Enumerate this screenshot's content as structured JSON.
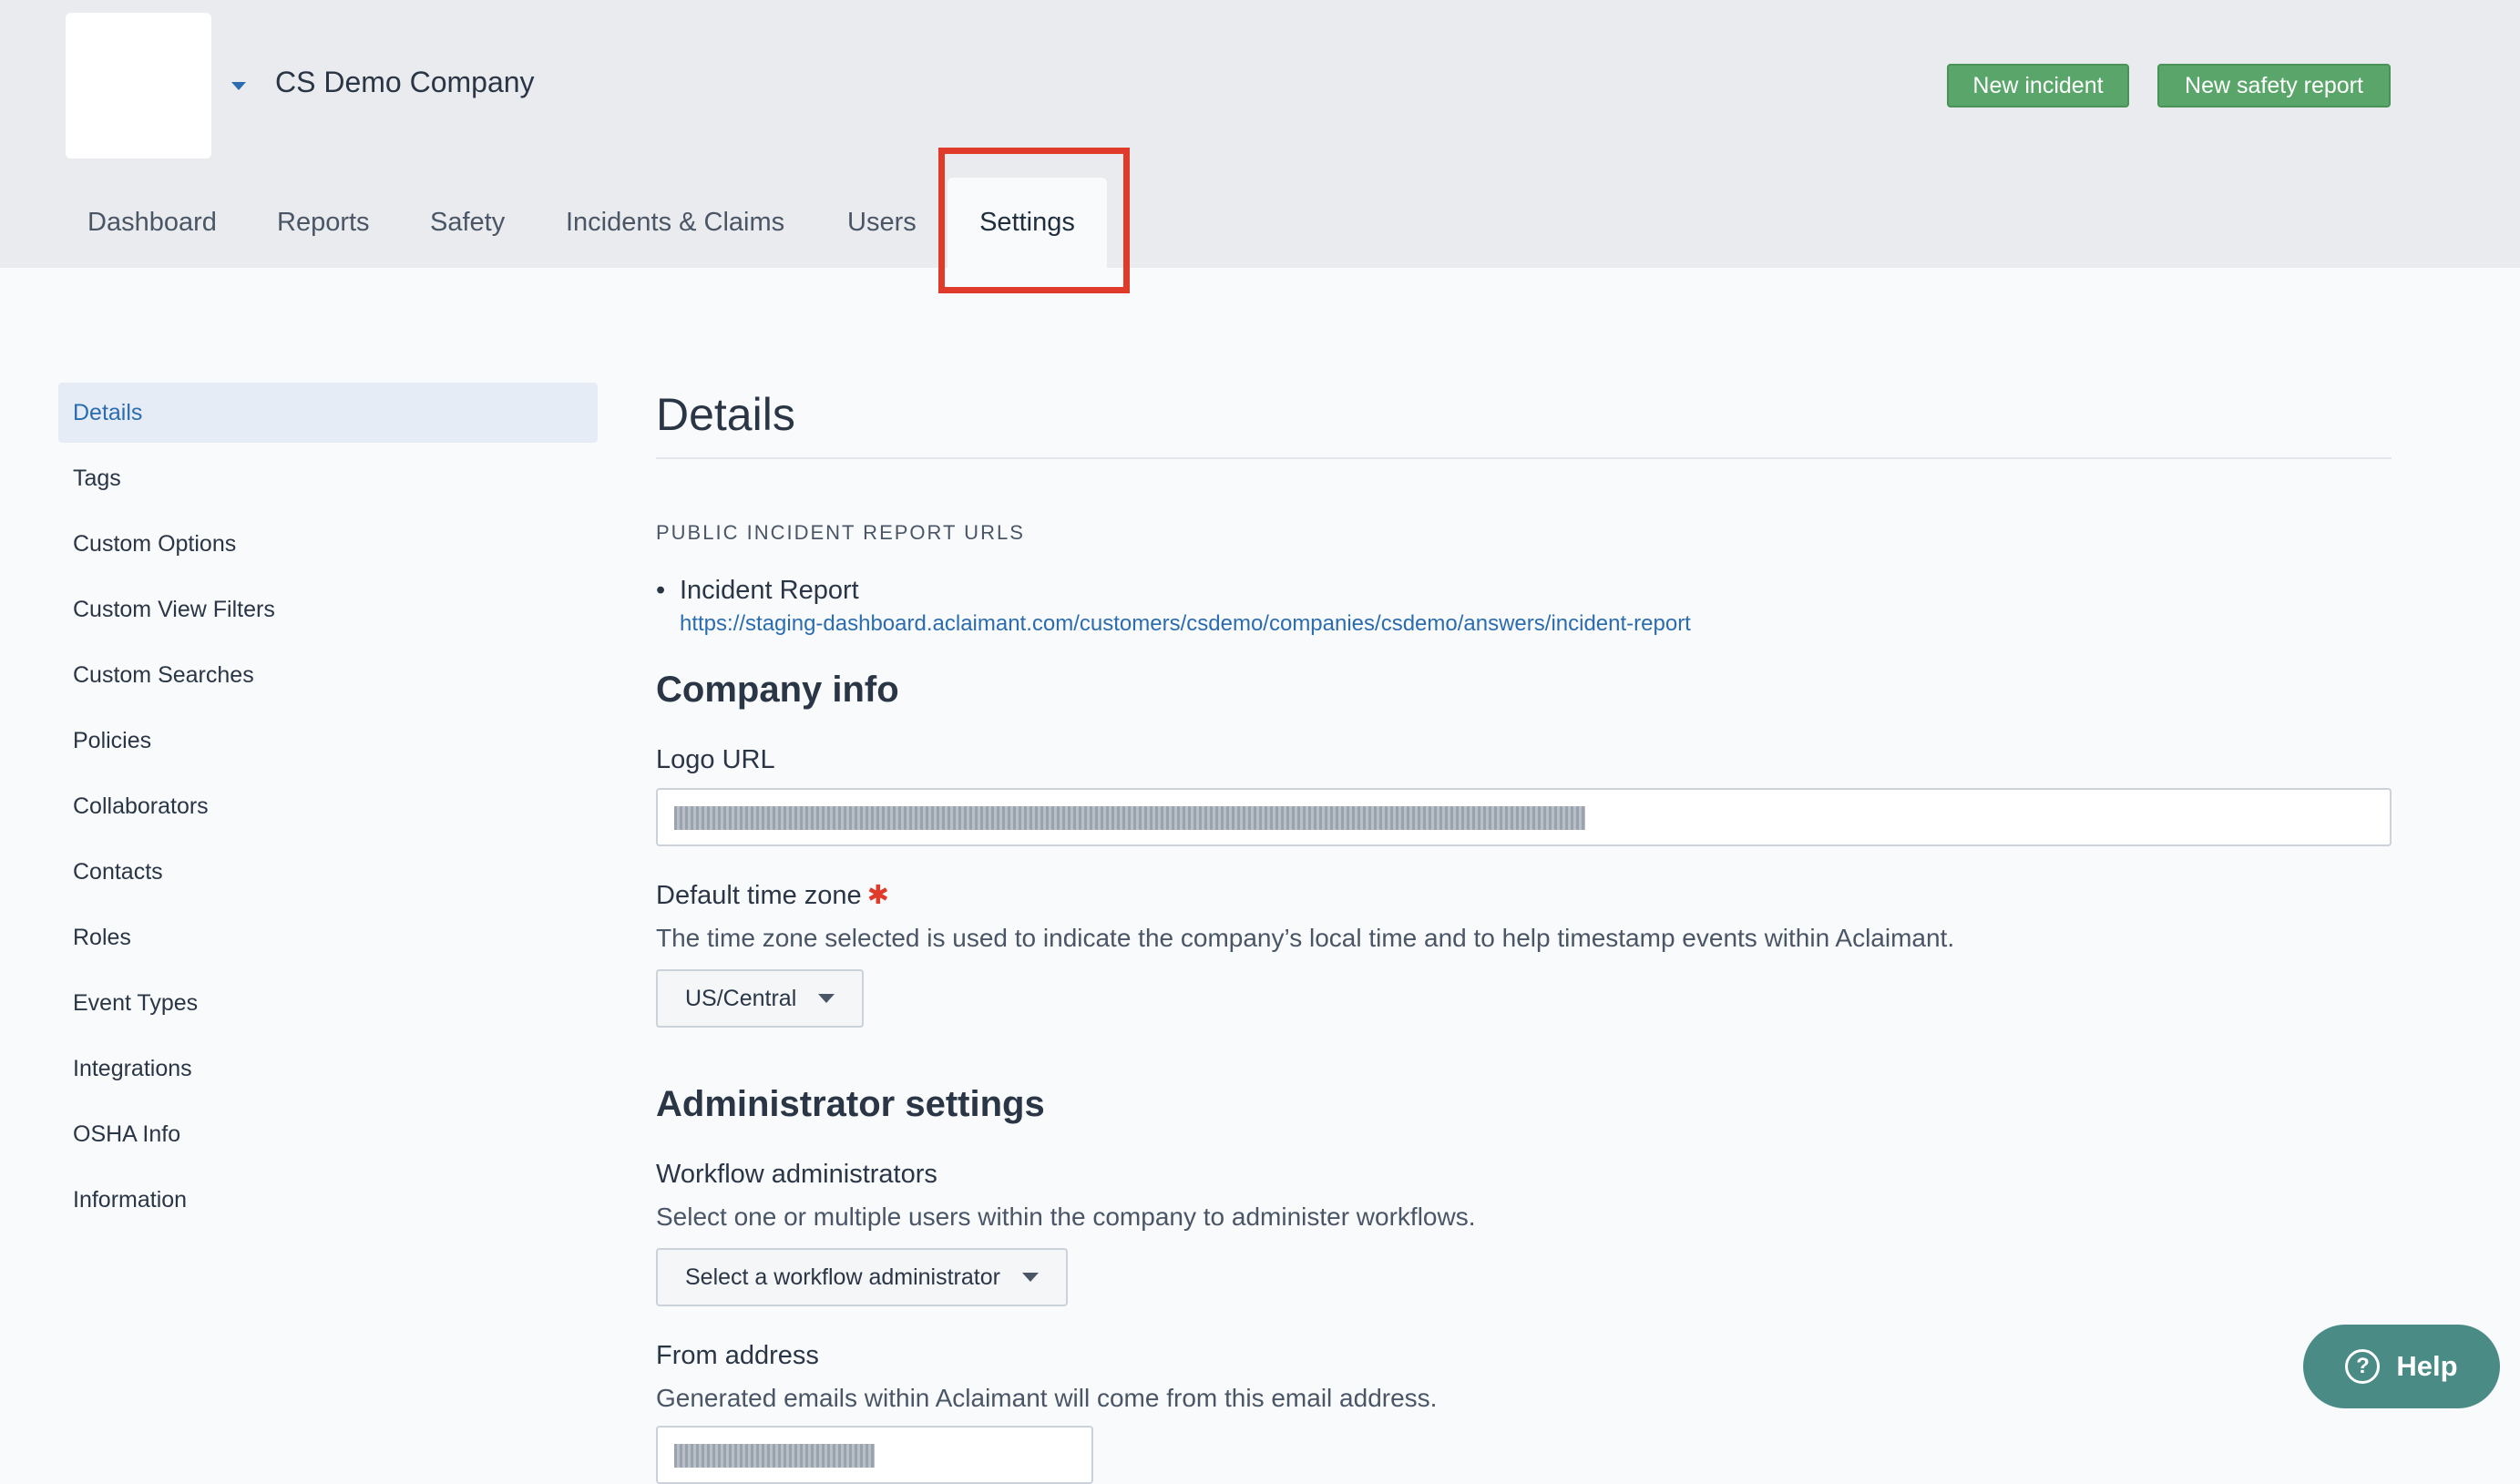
{
  "header": {
    "company_name": "CS Demo Company",
    "new_incident_label": "New incident",
    "new_safety_report_label": "New safety report"
  },
  "nav": {
    "tabs": [
      {
        "label": "Dashboard"
      },
      {
        "label": "Reports"
      },
      {
        "label": "Safety"
      },
      {
        "label": "Incidents & Claims"
      },
      {
        "label": "Users"
      },
      {
        "label": "Settings",
        "active": true
      }
    ]
  },
  "sidebar": {
    "items": [
      {
        "label": "Details",
        "active": true
      },
      {
        "label": "Tags"
      },
      {
        "label": "Custom Options"
      },
      {
        "label": "Custom View Filters"
      },
      {
        "label": "Custom Searches"
      },
      {
        "label": "Policies"
      },
      {
        "label": "Collaborators"
      },
      {
        "label": "Contacts"
      },
      {
        "label": "Roles"
      },
      {
        "label": "Event Types"
      },
      {
        "label": "Integrations"
      },
      {
        "label": "OSHA Info"
      },
      {
        "label": "Information"
      }
    ]
  },
  "main": {
    "title": "Details",
    "public_urls_label": "PUBLIC INCIDENT REPORT URLS",
    "incident_report_title": "Incident Report",
    "incident_report_url": "https://staging-dashboard.aclaimant.com/customers/csdemo/companies/csdemo/answers/incident-report",
    "company_info_heading": "Company info",
    "logo_url_label": "Logo URL",
    "time_zone_label": "Default time zone",
    "required_mark": "✱",
    "time_zone_help": "The time zone selected is used to indicate the company’s local time and to help timestamp events within Aclaimant.",
    "time_zone_value": "US/Central",
    "admin_heading": "Administrator settings",
    "workflow_admins_label": "Workflow administrators",
    "workflow_admins_help": "Select one or multiple users within the company to administer workflows.",
    "workflow_admin_placeholder": "Select a workflow administrator",
    "from_address_label": "From address",
    "from_address_help": "Generated emails within Aclaimant will come from this email address."
  },
  "help": {
    "label": "Help",
    "icon_glyph": "?"
  },
  "colors": {
    "accent": "#2b6cb0",
    "green_button": "#5aa66a",
    "highlight": "#e03a2a",
    "help_button": "#4a8b85"
  }
}
